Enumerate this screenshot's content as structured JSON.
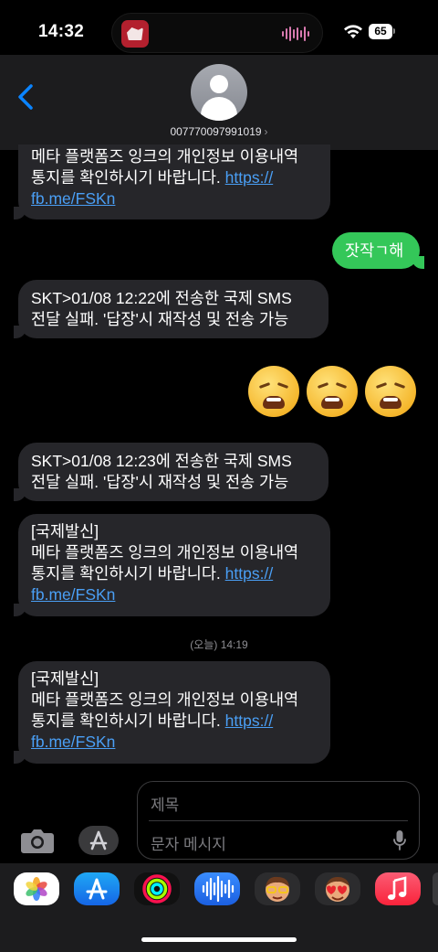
{
  "status_bar": {
    "time": "14:32",
    "battery": "65"
  },
  "header": {
    "contact": "007770097991019",
    "chevron": "›"
  },
  "messages": [
    {
      "lines": [
        "메타 플랫폼즈 잉크의 개인정보 이용내역",
        "통지를 확인하시기 바랍니다. "
      ],
      "link1": "https://",
      "link2": "fb.me/FSKn"
    },
    {
      "text": "잣작ㄱ해"
    },
    {
      "lines": [
        "SKT>01/08 12:22에 전송한 국제 SMS",
        "전달 실패. '답장'시 재작성 및 전송 가능"
      ]
    },
    {
      "emoji": "weary-face ×3"
    },
    {
      "lines": [
        "SKT>01/08 12:23에 전송한 국제 SMS",
        "전달 실패. '답장'시 재작성 및 전송 가능"
      ]
    },
    {
      "lines": [
        "[국제발신]",
        "메타 플랫폼즈 잉크의 개인정보 이용내역",
        "통지를 확인하시기 바랍니다. "
      ],
      "link1": "https://",
      "link2": "fb.me/FSKn"
    },
    {
      "lines": [
        "[국제발신]",
        "메타 플랫폼즈 잉크의 개인정보 이용내역",
        "통지를 확인하시기 바랍니다. "
      ],
      "link1": "https://",
      "link2": "fb.me/FSKn"
    }
  ],
  "timestamp": "(오늘) 14:19",
  "compose": {
    "subject_placeholder": "제목",
    "body_placeholder": "문자 메시지"
  },
  "app_drawer": [
    "photos-icon",
    "app-store-icon",
    "fitness-icon",
    "audio-icon",
    "memoji-icon",
    "memoji-icon-2",
    "music-icon"
  ],
  "colors": {
    "received": "#26262a",
    "sent": "#34c759",
    "link": "#4a9ff5",
    "accent": "#0a84ff"
  }
}
